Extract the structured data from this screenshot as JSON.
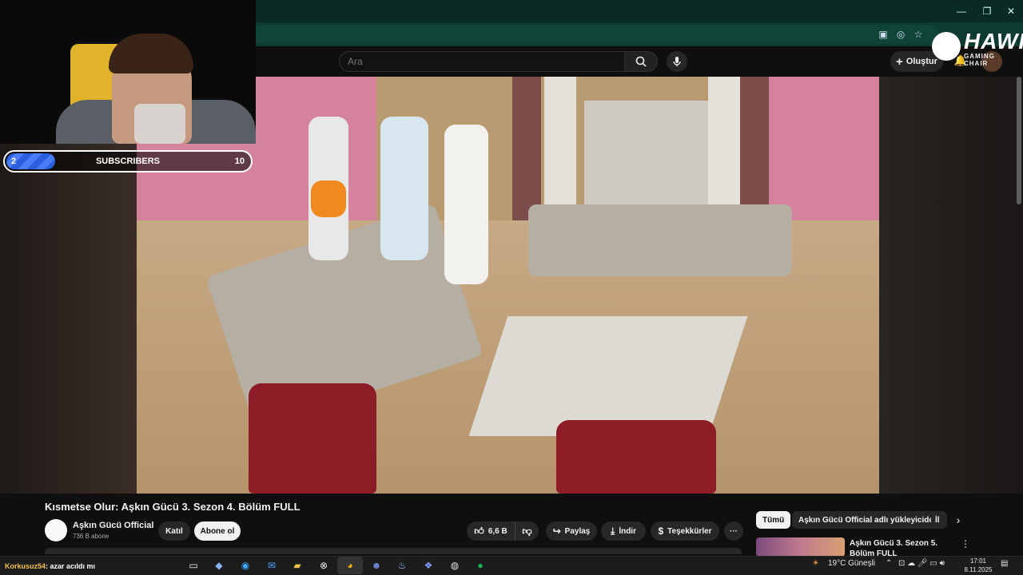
{
  "browser": {
    "window_controls": {
      "minimize": "—",
      "restore": "❐",
      "close": "✕"
    }
  },
  "youtube": {
    "search": {
      "placeholder": "Ara"
    },
    "create_label": "Oluştur"
  },
  "overlay": {
    "logo": {
      "title": "HAWK",
      "subtitle": "GAMING CHAIR"
    },
    "subscriber_goal": {
      "current": "2",
      "label": "SUBSCRIBERS",
      "goal": "10",
      "progress": 0.2
    },
    "chat": {
      "user": "Korkusuz54",
      "message": ": azar acıldı mı"
    }
  },
  "video": {
    "title": "Kısmetse Olur: Aşkın Gücü 3. Sezon 4. Bölüm FULL",
    "channel": {
      "name": "Aşkın Gücü Official",
      "subscribers": "736 B abone"
    },
    "buttons": {
      "join": "Katıl",
      "subscribe": "Abone ol",
      "like_count": "6,6 B",
      "share": "Paylaş",
      "download": "İndir",
      "thanks": "Teşekkürler",
      "more": "···"
    }
  },
  "recommendations": {
    "chips": [
      "Tümü",
      "Aşkın Gücü Official adlı yükleyiciden",
      "İl"
    ],
    "items": [
      {
        "title": "Aşkın Gücü 3. Sezon 5. Bölüm FULL"
      }
    ]
  },
  "taskbar": {
    "weather": "19°C  Güneşli",
    "time": "17:01",
    "date": "8.11.2025"
  },
  "colors": {
    "titlebar": "#0a2a24",
    "yt_background": "#0f0f0f",
    "subscribe_button": "#f1f1f1",
    "progress_fill": "#2a5fe0"
  }
}
